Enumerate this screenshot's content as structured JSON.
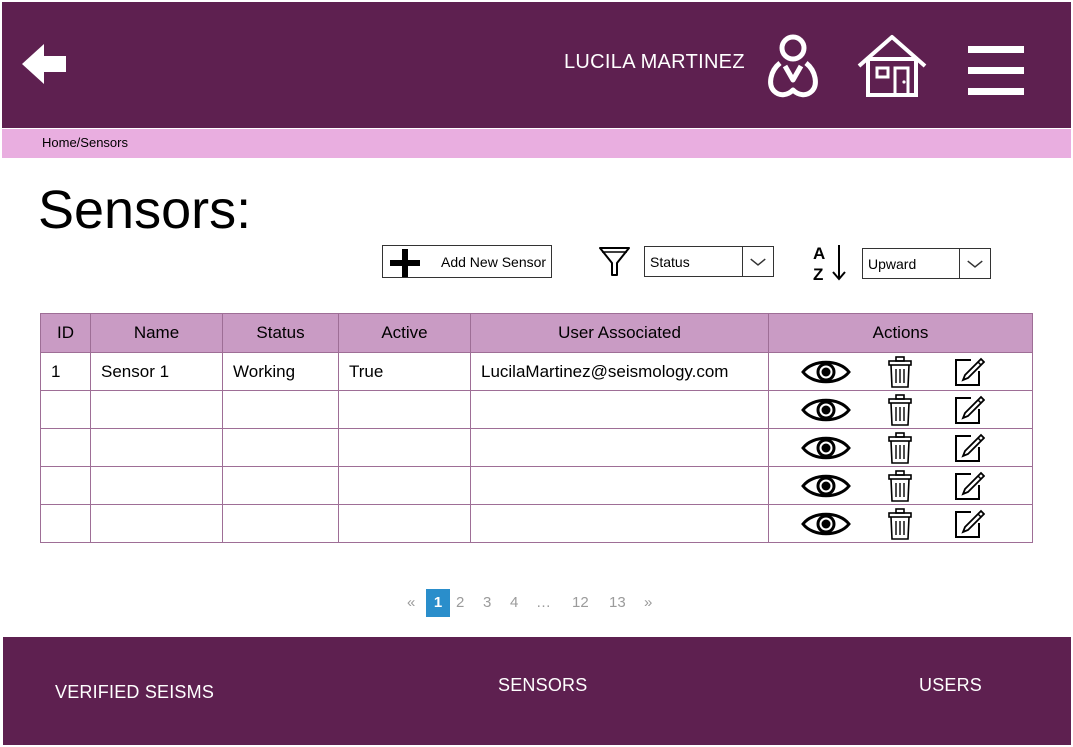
{
  "header": {
    "user_name": "LUCILA MARTINEZ"
  },
  "breadcrumb": "Home/Sensors",
  "page": {
    "title": "Sensors:"
  },
  "toolbar": {
    "add_label": "Add New Sensor",
    "status_filter": "Status",
    "sort_order": "Upward"
  },
  "table": {
    "columns": [
      "ID",
      "Name",
      "Status",
      "Active",
      "User Associated",
      "Actions"
    ],
    "rows": [
      {
        "id": "1",
        "name": "Sensor 1",
        "status": "Working",
        "active": "True",
        "user": "LucilaMartinez@seismology.com"
      },
      {
        "id": "",
        "name": "",
        "status": "",
        "active": "",
        "user": ""
      },
      {
        "id": "",
        "name": "",
        "status": "",
        "active": "",
        "user": ""
      },
      {
        "id": "",
        "name": "",
        "status": "",
        "active": "",
        "user": ""
      },
      {
        "id": "",
        "name": "",
        "status": "",
        "active": "",
        "user": ""
      }
    ]
  },
  "pagination": {
    "prev": "«",
    "pages": [
      "1",
      "2",
      "3",
      "4",
      "…",
      "12",
      "13"
    ],
    "current": 1,
    "next": "»"
  },
  "footer": {
    "nav": [
      "VERIFIED SEISMS",
      "SENSORS",
      "USERS"
    ]
  },
  "colors": {
    "header_bg": "#5e2050",
    "breadcrumb_bg": "#e9aee0",
    "table_header_bg": "#c99bc4",
    "pager_active": "#2a8ecb"
  }
}
